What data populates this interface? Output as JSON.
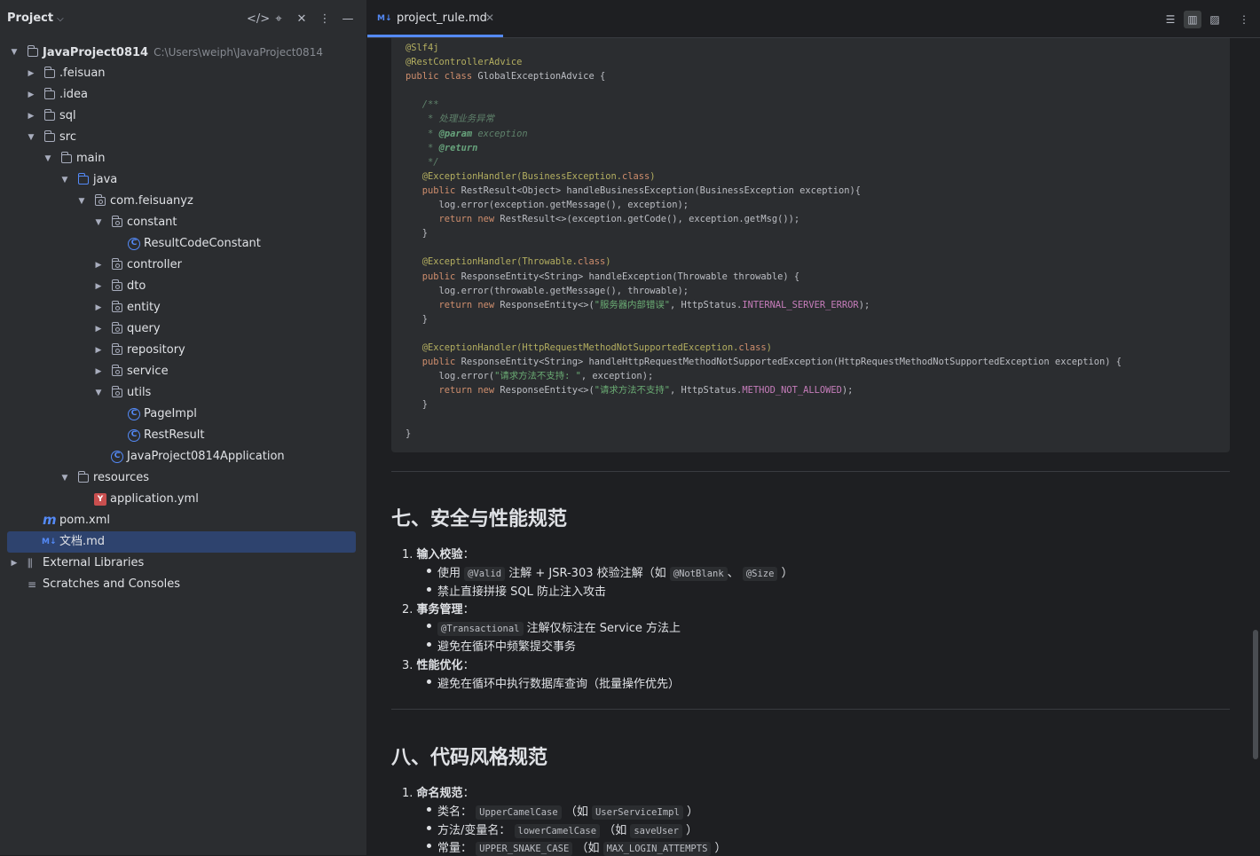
{
  "project": {
    "title": "Project",
    "tree": [
      {
        "label": "JavaProject0814",
        "path": "C:\\Users\\weiph\\JavaProject0814",
        "icon": "module-folder-icon",
        "expanded": true
      },
      {
        "label": ".feisuan",
        "icon": "folder-icon",
        "expanded": false
      },
      {
        "label": ".idea",
        "icon": "folder-icon",
        "expanded": false
      },
      {
        "label": "sql",
        "icon": "folder-icon",
        "expanded": false
      },
      {
        "label": "src",
        "icon": "folder-icon",
        "expanded": true
      },
      {
        "label": "main",
        "icon": "folder-icon",
        "expanded": true
      },
      {
        "label": "java",
        "icon": "source-folder-icon",
        "expanded": true
      },
      {
        "label": "com.feisuanyz",
        "icon": "package-icon",
        "expanded": true
      },
      {
        "label": "constant",
        "icon": "package-icon",
        "expanded": true
      },
      {
        "label": "ResultCodeConstant",
        "icon": "class-icon"
      },
      {
        "label": "controller",
        "icon": "package-icon",
        "expanded": false
      },
      {
        "label": "dto",
        "icon": "package-icon",
        "expanded": false
      },
      {
        "label": "entity",
        "icon": "package-icon",
        "expanded": false
      },
      {
        "label": "query",
        "icon": "package-icon",
        "expanded": false
      },
      {
        "label": "repository",
        "icon": "package-icon",
        "expanded": false
      },
      {
        "label": "service",
        "icon": "package-icon",
        "expanded": false
      },
      {
        "label": "utils",
        "icon": "package-icon",
        "expanded": true
      },
      {
        "label": "PageImpl",
        "icon": "class-icon"
      },
      {
        "label": "RestResult",
        "icon": "class-icon"
      },
      {
        "label": "JavaProject0814Application",
        "icon": "spring-boot-class-icon"
      },
      {
        "label": "resources",
        "icon": "folder-icon",
        "expanded": true
      },
      {
        "label": "application.yml",
        "icon": "yaml-file-icon"
      },
      {
        "label": "pom.xml",
        "icon": "maven-icon"
      },
      {
        "label": "文档.md",
        "icon": "markdown-icon",
        "selected": true
      },
      {
        "label": "External Libraries",
        "icon": "library-icon",
        "expanded": false
      },
      {
        "label": "Scratches and Consoles",
        "icon": "scratches-icon"
      }
    ]
  },
  "editor": {
    "tab": {
      "label": "project_rule.md",
      "icon": "markdown-icon",
      "badge": "M↓"
    },
    "code": {
      "l1": "@Slf4j",
      "l2": "@RestControllerAdvice",
      "l3_kw": "public class ",
      "l3": "GlobalExceptionAdvice {",
      "c1": "/**",
      "c2": " * 处理业务异常",
      "c3_tag": "@param",
      "c3": " exception",
      "c4_tag": "@return",
      "c5": " */",
      "a1": "@ExceptionHandler(BusinessException.",
      "a1_kw": "class",
      "a1_end": ")",
      "m1_kw": "public ",
      "m1": "RestResult<Object> handleBusinessException(BusinessException exception){",
      "b1": "log.error(exception.getMessage(), exception);",
      "b2_kw": "return new ",
      "b2": "RestResult<>(exception.getCode(), exception.getMsg());",
      "brace": "}",
      "a2": "@ExceptionHandler(Throwable.",
      "a2_kw": "class",
      "a2_end": ")",
      "m2_kw": "public ",
      "m2": "ResponseEntity<String> handleException(Throwable throwable) {",
      "b3": "log.error(throwable.getMessage(), throwable);",
      "b4_kw": "return new ",
      "b4": "ResponseEntity<>(",
      "b4_str": "\"服务器内部错误\"",
      "b4_mid": ", HttpStatus.",
      "b4_fld": "INTERNAL_SERVER_ERROR",
      "b4_end": ");",
      "a3": "@ExceptionHandler(HttpRequestMethodNotSupportedException.",
      "a3_kw": "class",
      "a3_end": ")",
      "m3_kw": "public ",
      "m3": "ResponseEntity<String> handleHttpRequestMethodNotSupportedException(HttpRequestMethodNotSupportedException exception) {",
      "b5": "log.error(",
      "b5_str": "\"请求方法不支持: \"",
      "b5_end": ", exception);",
      "b6_kw": "return new ",
      "b6": "ResponseEntity<>(",
      "b6_str": "\"请求方法不支持\"",
      "b6_mid": ", HttpStatus.",
      "b6_fld": "METHOD_NOT_ALLOWED",
      "b6_end": ");",
      "close": "}"
    },
    "s7": {
      "heading": "七、安全与性能规范",
      "i1_num": "1.",
      "i1_title": "输入校验",
      "i1_b1_a": "使用",
      "i1_b1_code1": "@Valid",
      "i1_b1_b": "注解 + JSR-303 校验注解（如",
      "i1_b1_code2": "@NotBlank",
      "i1_b1_c": "、",
      "i1_b1_code3": "@Size",
      "i1_b1_d": "）",
      "i1_b2": "禁止直接拼接 SQL 防止注入攻击",
      "i2_num": "2.",
      "i2_title": "事务管理",
      "i2_b1_code": "@Transactional",
      "i2_b1": "注解仅标注在 Service 方法上",
      "i2_b2": "避免在循环中频繁提交事务",
      "i3_num": "3.",
      "i3_title": "性能优化",
      "i3_b1": "避免在循环中执行数据库查询（批量操作优先）"
    },
    "s8": {
      "heading": "八、代码风格规范",
      "i1_num": "1.",
      "i1_title": "命名规范",
      "b1_a": "类名：",
      "b1_code1": "UpperCamelCase",
      "b1_b": "（如",
      "b1_code2": "UserServiceImpl",
      "b1_c": "）",
      "b2_a": "方法/变量名：",
      "b2_code1": "lowerCamelCase",
      "b2_b": "（如",
      "b2_code2": "saveUser",
      "b2_c": "）",
      "b3_a": "常量：",
      "b3_code1": "UPPER_SNAKE_CASE",
      "b3_b": "（如",
      "b3_code2": "MAX_LOGIN_ATTEMPTS",
      "b3_c": "）"
    }
  }
}
